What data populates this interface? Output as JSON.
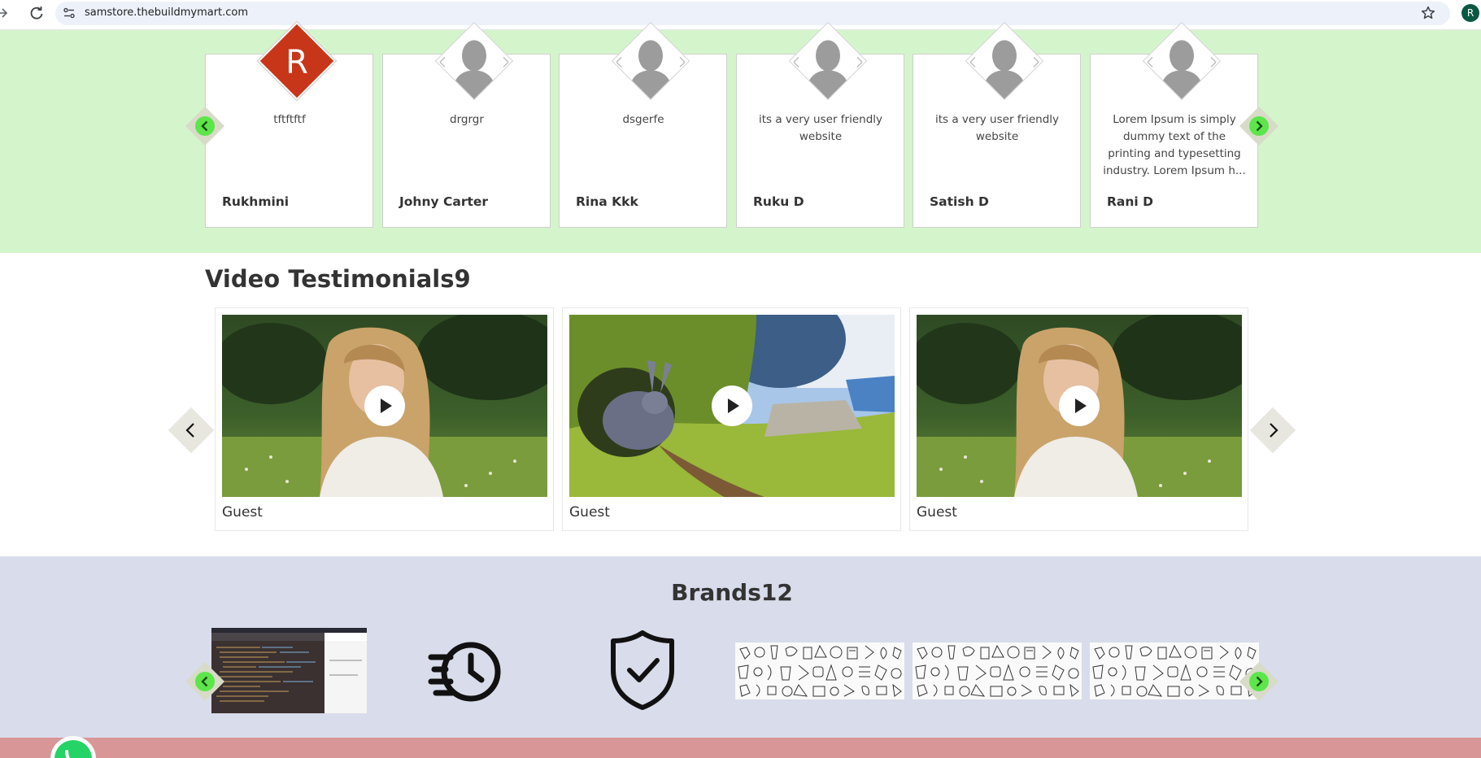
{
  "browser": {
    "url": "samstore.thebuildmymart.com",
    "profile_initial": "R"
  },
  "testimonials": [
    {
      "avatar_type": "letter",
      "avatar_letter": "R",
      "comment": "tftftftf",
      "name": "Rukhmini"
    },
    {
      "avatar_type": "silhouette",
      "comment": "drgrgr",
      "name": "Johny Carter"
    },
    {
      "avatar_type": "silhouette",
      "comment": "dsgerfe",
      "name": "Rina Kkk"
    },
    {
      "avatar_type": "silhouette",
      "comment": "its a very user friendly website",
      "name": "Ruku D"
    },
    {
      "avatar_type": "silhouette",
      "comment": "its a very user friendly website",
      "name": "Satish D"
    },
    {
      "avatar_type": "silhouette",
      "comment": "Lorem Ipsum is simply dummy text of the printing and typesetting industry. Lorem Ipsum h...",
      "name": "Rani D"
    }
  ],
  "video_section": {
    "title": "Video Testimonials9",
    "videos": [
      {
        "thumbnail": "woman-in-field",
        "name": "Guest"
      },
      {
        "thumbnail": "bunny-cartoon",
        "name": "Guest"
      },
      {
        "thumbnail": "woman-in-field",
        "name": "Guest"
      }
    ]
  },
  "brands_section": {
    "title": "Brands12",
    "brands": [
      "code-screenshot-logo",
      "fast-clock-icon",
      "shield-check-icon",
      "doodle-pattern-logo",
      "doodle-pattern-logo",
      "doodle-pattern-logo"
    ]
  },
  "colors": {
    "testimonial_bg": "#d4f5cb",
    "brands_bg": "#d9dcea",
    "arrow_green": "#5ce64a",
    "avatar_letter_bg": "#c8361a",
    "footer_bg": "#d99696",
    "whatsapp": "#25d366"
  }
}
